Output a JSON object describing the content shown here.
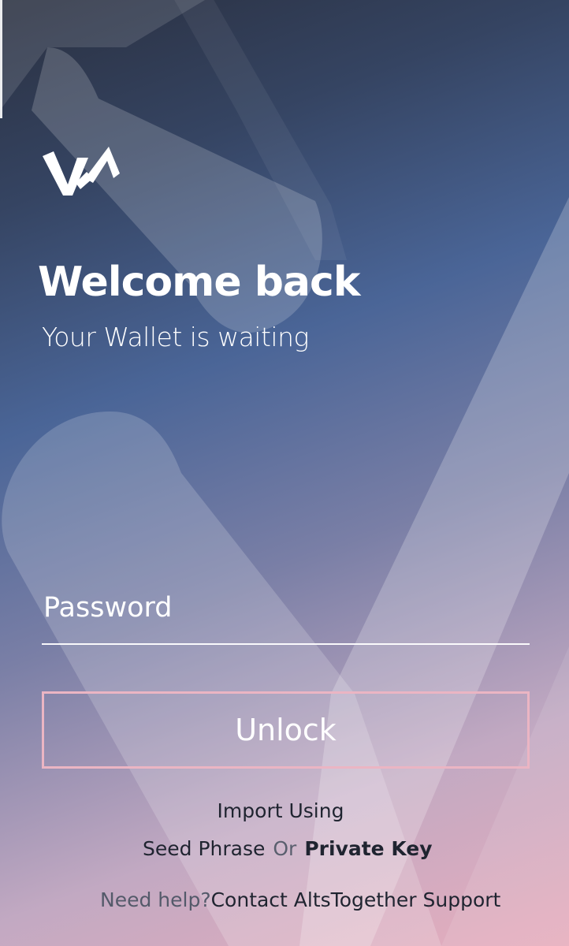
{
  "app": {
    "logo_icon": "altstogether-logo-icon"
  },
  "welcome": {
    "title": "Welcome back",
    "subtitle": "Your Wallet is waiting"
  },
  "password": {
    "placeholder": "Password",
    "value": ""
  },
  "unlock": {
    "label": "Unlock"
  },
  "import": {
    "label": "Import Using",
    "seed_phrase": "Seed Phrase",
    "or": "Or",
    "private_key": "Private Key"
  },
  "help": {
    "question": "Need help?",
    "contact": "Contact AltsTogether Support"
  },
  "colors": {
    "unlock_border": "#ebb5c3",
    "dark_text": "#1f2430",
    "muted_text": "#545a6a"
  }
}
